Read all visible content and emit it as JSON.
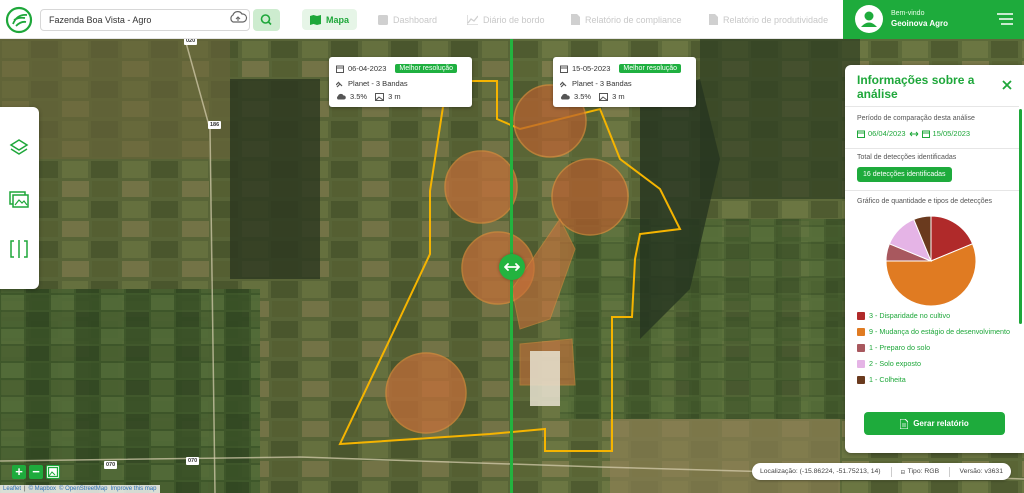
{
  "app": {
    "farm_name": "Fazenda Boa Vista - Agro",
    "search_placeholder": "Fazenda Boa Vista - Agro"
  },
  "nav": [
    {
      "label": "Mapa",
      "icon": "map-icon",
      "active": true
    },
    {
      "label": "Dashboard",
      "icon": "dashboard-icon",
      "active": false
    },
    {
      "label": "Diário de bordo",
      "icon": "chart-line-icon",
      "active": false
    },
    {
      "label": "Relatório de compliance",
      "icon": "document-icon",
      "active": false
    },
    {
      "label": "Relatório de produtividade",
      "icon": "document-icon",
      "active": false
    }
  ],
  "user": {
    "greeting": "Bem-vindo",
    "name": "Geoinova Agro"
  },
  "left_tools": [
    {
      "icon": "layers-icon"
    },
    {
      "icon": "images-icon"
    },
    {
      "icon": "compare-icon"
    }
  ],
  "cards": {
    "left": {
      "date": "06-04-2023",
      "badge": "Melhor resolução",
      "source": "Planet - 3 Bandas",
      "cloud": "3.5%",
      "resolution": "3 m"
    },
    "right": {
      "date": "15-05-2023",
      "badge": "Melhor resolução",
      "source": "Planet - 3 Bandas",
      "cloud": "3.5%",
      "resolution": "3 m"
    }
  },
  "panel": {
    "title": "Informações sobre a análise",
    "period_label": "Período de comparação desta análise",
    "period_start": "06/04/2023",
    "period_end": "15/05/2023",
    "total_label": "Total de detecções identificadas",
    "total_badge": "16 detecções identificadas",
    "chart_label": "Gráfico de quantidade e tipos de detecções",
    "report_button": "Gerar relatório"
  },
  "chart_data": {
    "type": "pie",
    "series": [
      {
        "name": "3 - Disparidade no cultivo",
        "value": 3,
        "color": "#b02a2a"
      },
      {
        "name": "9 - Mudança do estágio de desenvolvimento",
        "value": 9,
        "color": "#e07b22"
      },
      {
        "name": "1 - Preparo do solo",
        "value": 1,
        "color": "#a8585e"
      },
      {
        "name": "2 - Solo exposto",
        "value": 2,
        "color": "#e5b4e6"
      },
      {
        "name": "1 - Colheita",
        "value": 1,
        "color": "#6a3a1e"
      }
    ]
  },
  "map": {
    "road_labels": [
      "020",
      "186",
      "070",
      "070"
    ],
    "zoom_in": "+",
    "zoom_out": "−"
  },
  "attribution": {
    "leaflet": "Leaflet",
    "mapbox": "© Mapbox",
    "osm": "© OpenStreetMap",
    "improve": "Improve this map"
  },
  "status": {
    "location": "Localização: (-15.86224, -51.75213, 14)",
    "type": "Tipo: RGB",
    "version": "Versão: v3631"
  }
}
